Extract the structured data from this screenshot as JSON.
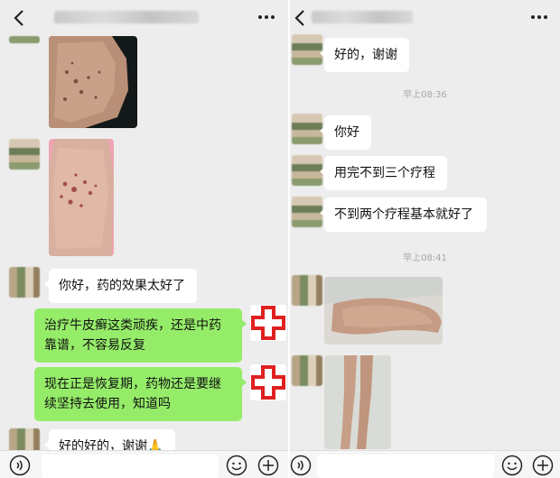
{
  "left": {
    "messages": {
      "m1": "你好，药的效果太好了",
      "m2": "治疗牛皮癣这类顽疾，还是中药靠谱，不容易反复",
      "m3": "现在正是恢复期，药物还是要继续坚持去使用，知道吗",
      "m4": "好的好的，谢谢🙏"
    }
  },
  "right": {
    "messages": {
      "m1": "好的，谢谢",
      "t1": "早上08:36",
      "m2": "你好",
      "m3": "用完不到三个疗程",
      "m4": "不到两个疗程基本就好了",
      "t2": "早上08:41"
    }
  },
  "icons": {
    "back": "chevron-left-icon",
    "more": "more-dots-icon",
    "voice": "voice-icon",
    "emoji": "emoji-icon",
    "plus": "plus-icon",
    "red_cross": "red-cross-icon"
  },
  "colors": {
    "chat_bg": "#ededed",
    "self_bubble": "#95ec69",
    "other_bubble": "#ffffff",
    "cross_red": "#e02020"
  }
}
